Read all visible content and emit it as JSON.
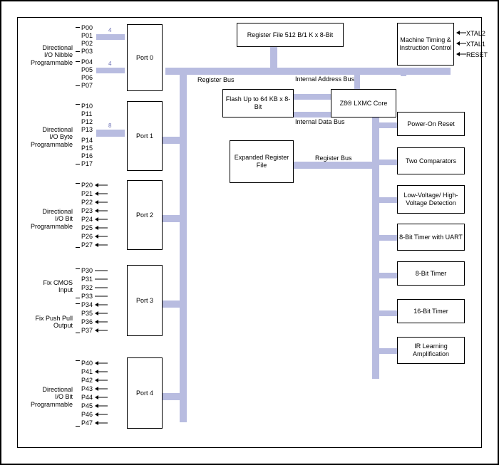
{
  "diagram": {
    "ports": {
      "port0": {
        "title": "Port 0",
        "pins": [
          "P00",
          "P01",
          "P02",
          "P03",
          "P04",
          "P05",
          "P06",
          "P07"
        ],
        "group_label": "Directional\nI/O Nibble\nProgrammable"
      },
      "port1": {
        "title": "Port 1",
        "pins": [
          "P10",
          "P11",
          "P12",
          "P13",
          "P14",
          "P15",
          "P16",
          "P17"
        ],
        "group_label": "Directional\nI/O Byte\nProgrammable"
      },
      "port2": {
        "title": "Port 2",
        "pins": [
          "P20",
          "P21",
          "P22",
          "P23",
          "P24",
          "P25",
          "P26",
          "P27"
        ],
        "group_label": "Directional\nI/O Bit\nProgrammable"
      },
      "port3": {
        "title": "Port 3",
        "pins": [
          "P30",
          "P31",
          "P32",
          "P33",
          "P34",
          "P35",
          "P36",
          "P37"
        ],
        "group_label_top": "Fix CMOS\nInput",
        "group_label_bot": "Fix Push Pull\nOutput"
      },
      "port4": {
        "title": "Port 4",
        "pins": [
          "P40",
          "P41",
          "P42",
          "P43",
          "P44",
          "P45",
          "P46",
          "P47"
        ],
        "group_label": "Directional\nI/O Bit\nProgrammable"
      }
    },
    "buswidths": {
      "port0a": "4",
      "port0b": "4",
      "port1": "8"
    },
    "blocks": {
      "regfile": "Register File\n512 B/1 K x 8-Bit",
      "flash": "Flash\nUp to 64 KB x 8-Bit",
      "core": "Z8® LXMC Core",
      "erf": "Expanded\nRegister\nFile",
      "mtic": "Machine\nTiming &\nInstruction\nControl",
      "por": "Power-On Reset",
      "cmp": "Two\nComparators",
      "lvd": "Low-Voltage/\nHigh-Voltage\nDetection",
      "t8u": "8-Bit Timer\nwith UART",
      "t8": "8-Bit Timer",
      "t16": "16-Bit Timer",
      "ir": "IR Learning\nAmplification"
    },
    "bus_labels": {
      "regbus": "Register Bus",
      "iab": "Internal\nAddress Bus",
      "idb": "Internal\nData Bus",
      "regbus2": "Register Bus"
    },
    "xtals": {
      "x2": "XTAL2",
      "x1": "XTAL1",
      "rst": "RESET"
    }
  }
}
